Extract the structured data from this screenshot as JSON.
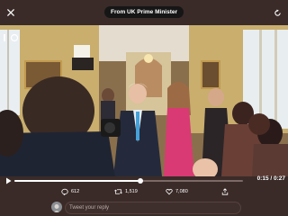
{
  "header": {
    "source_label": "From UK Prime Minister",
    "close_icon": "close-icon",
    "refresh_icon": "rotate-icon"
  },
  "player": {
    "progress": 0.55,
    "time": "0:15 / 0:27",
    "play_icon": "play-icon",
    "pause_icon": "pause-icon",
    "volume_icon": "volume-icon"
  },
  "actions": {
    "replies": "612",
    "retweets": "1,519",
    "likes": "7,080",
    "share_icon": "share-icon"
  },
  "reply": {
    "placeholder": "Tweet your reply"
  },
  "colors": {
    "background": "#3a2b28",
    "accent_dress": "#d93a73",
    "progress": "#ffffff"
  }
}
